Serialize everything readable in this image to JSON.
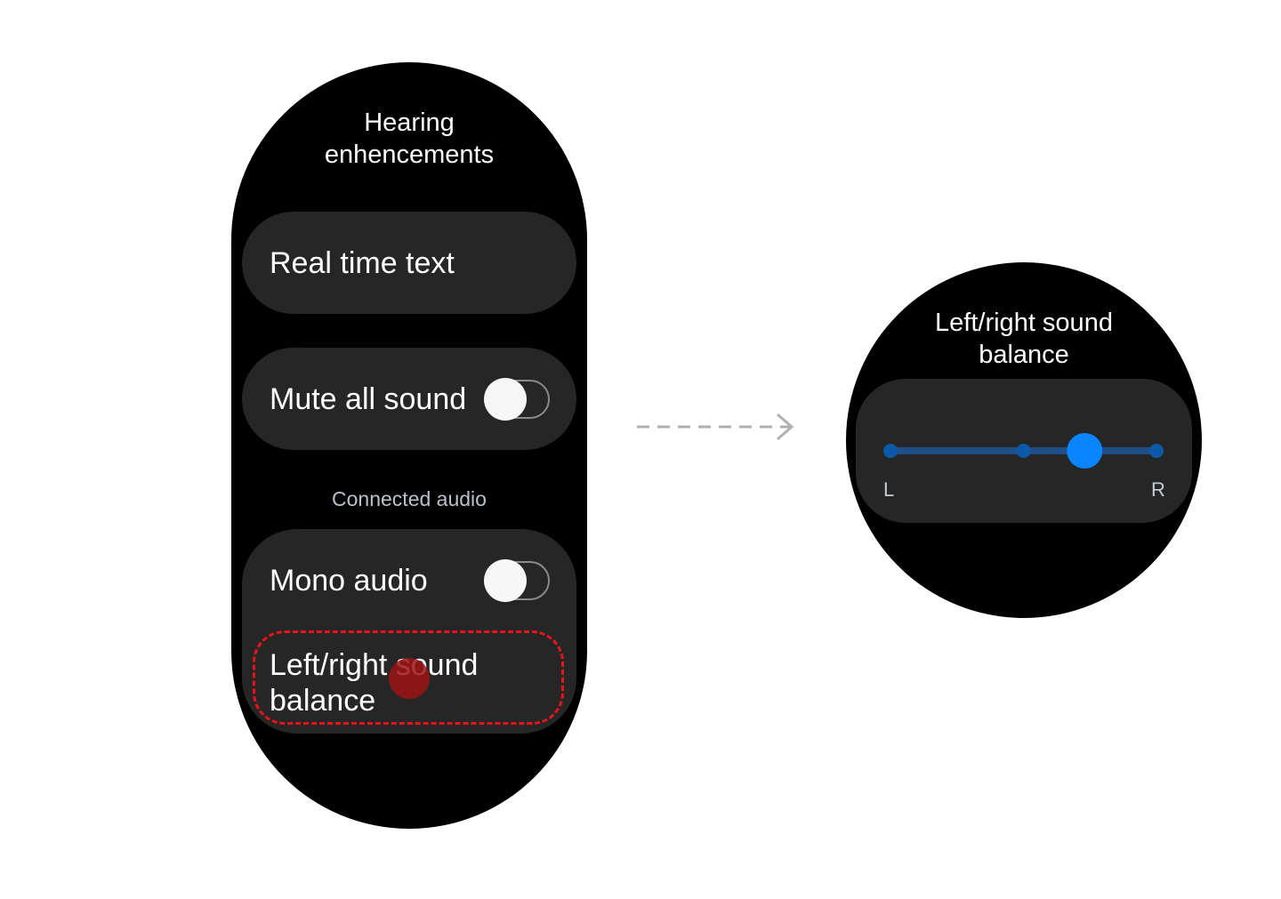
{
  "main_screen": {
    "title": "Hearing enhencements",
    "items": [
      {
        "label": "Real time text"
      },
      {
        "label": "Mute all sound",
        "toggle": false
      }
    ],
    "section_header": "Connected audio",
    "section_items": [
      {
        "label": "Mono audio",
        "toggle": false
      },
      {
        "label": "Left/right sound balance",
        "highlighted": true
      }
    ]
  },
  "detail_screen": {
    "title": "Left/right sound balance",
    "slider": {
      "left_label": "L",
      "right_label": "R",
      "value": 0.73,
      "ticks": [
        0,
        0.5,
        1
      ]
    }
  },
  "colors": {
    "accent": "#0a84ff",
    "track": "#1f4f86",
    "highlight": "#e8141c",
    "tap": "#9b1515"
  }
}
